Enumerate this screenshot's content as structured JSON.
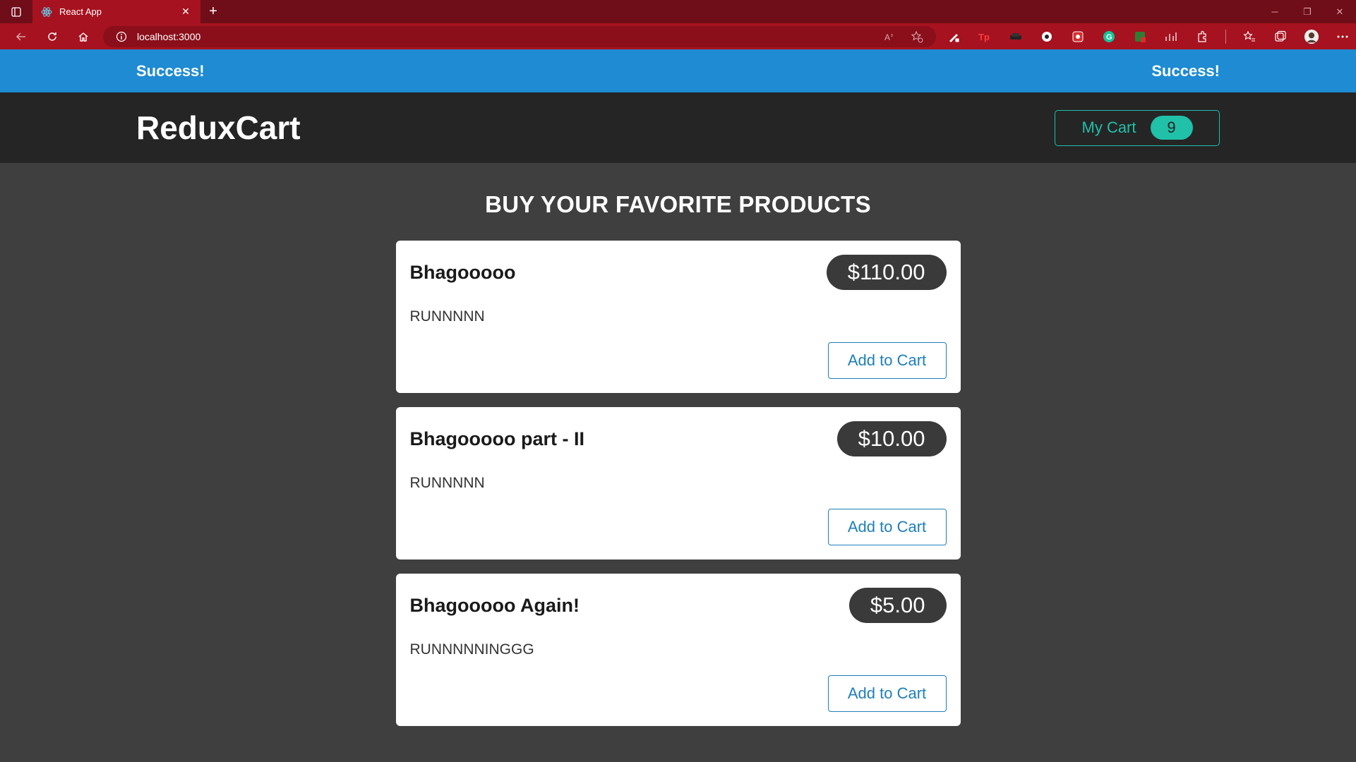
{
  "browser": {
    "tab_title": "React App",
    "url": "localhost:3000"
  },
  "notification": {
    "title": "Success!",
    "message": "Success!",
    "color": "#1e8bd2"
  },
  "header": {
    "brand": "ReduxCart",
    "cart_label": "My Cart",
    "cart_count": "9",
    "accent_color": "#20c0a9"
  },
  "main": {
    "heading": "BUY YOUR FAVORITE PRODUCTS",
    "products": [
      {
        "name": "Bhagooooo",
        "price": "$110.00",
        "description": "RUNNNNN",
        "button": "Add to Cart"
      },
      {
        "name": "Bhagooooo part - II",
        "price": "$10.00",
        "description": "RUNNNNN",
        "button": "Add to Cart"
      },
      {
        "name": "Bhagooooo Again!",
        "price": "$5.00",
        "description": "RUNNNNNINGGG",
        "button": "Add to Cart"
      }
    ]
  }
}
